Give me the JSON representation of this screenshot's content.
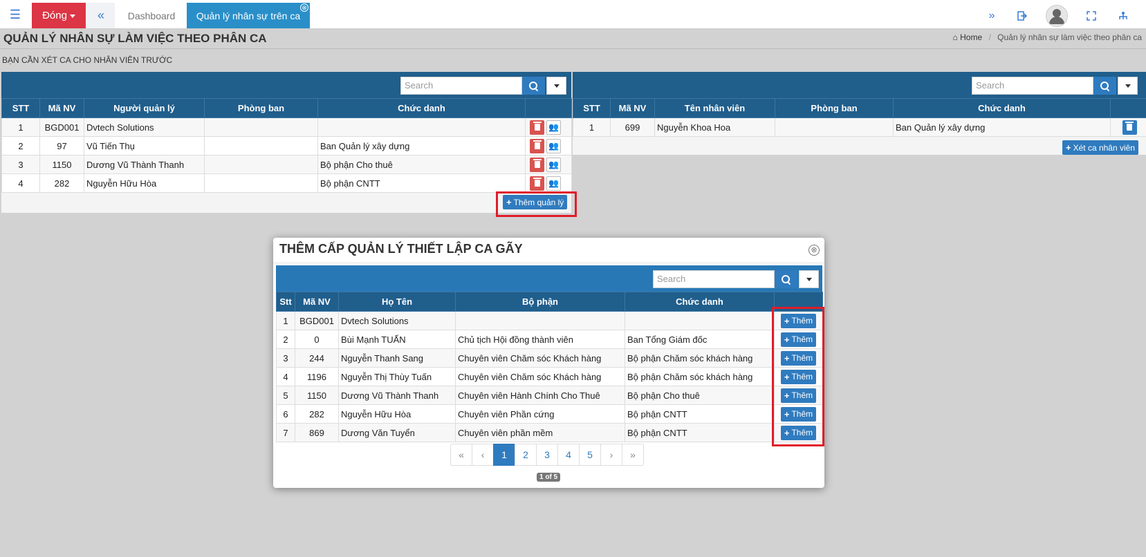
{
  "topbar": {
    "menu_icon": "hamburger-icon",
    "close_label": "Đóng",
    "tabs": [
      {
        "label": "Dashboard"
      },
      {
        "label": "Quản lý nhân sự trên ca"
      }
    ],
    "tab_close_glyph": "⊗"
  },
  "header": {
    "title": "QUẢN LÝ NHÂN SỰ LÀM VIỆC THEO PHÂN CA",
    "breadcrumb": [
      "Home",
      "Quản lý nhân sự làm việc theo phân ca"
    ],
    "notice": "BẠN CẦN XÉT CA CHO NHÂN VIÊN TRƯỚC"
  },
  "left_panel": {
    "search_placeholder": "Search",
    "columns": [
      "STT",
      "Mã NV",
      "Người quản lý",
      "Phòng ban",
      "Chức danh",
      ""
    ],
    "rows": [
      {
        "stt": "1",
        "ma_nv": "BGD001",
        "name": "Dvtech Solutions",
        "dept": "",
        "title": ""
      },
      {
        "stt": "2",
        "ma_nv": "97",
        "name": "Vũ Tiến Thụ",
        "dept": "",
        "title": "Ban Quản lý xây dựng"
      },
      {
        "stt": "3",
        "ma_nv": "1150",
        "name": "Dương Vũ Thành Thanh",
        "dept": "",
        "title": "Bộ phận Cho thuê"
      },
      {
        "stt": "4",
        "ma_nv": "282",
        "name": "Nguyễn Hữu Hòa",
        "dept": "",
        "title": "Bộ phận CNTT"
      }
    ],
    "add_button": "Thêm quản lý"
  },
  "right_panel": {
    "search_placeholder": "Search",
    "columns": [
      "STT",
      "Mã NV",
      "Tên nhân viên",
      "Phòng ban",
      "Chức danh",
      ""
    ],
    "rows": [
      {
        "stt": "1",
        "ma_nv": "699",
        "name": "Nguyễn Khoa Hoa",
        "dept": "",
        "title": "Ban Quản lý xây dựng"
      }
    ],
    "add_button": "Xét ca nhân viên"
  },
  "modal": {
    "title": "THÊM CẤP QUẢN LÝ THIẾT LẬP CA GÃY",
    "close_glyph": "⊗",
    "search_placeholder": "Search",
    "columns": [
      "Stt",
      "Mã NV",
      "Họ Tên",
      "Bộ phận",
      "Chức danh",
      ""
    ],
    "rows": [
      {
        "stt": "1",
        "ma_nv": "BGD001",
        "name": "Dvtech Solutions",
        "dept": "",
        "title": ""
      },
      {
        "stt": "2",
        "ma_nv": "0",
        "name": "Bùi Mạnh TUẤN",
        "dept": "Chủ tịch Hội đồng thành viên",
        "title": "Ban Tổng Giám đốc"
      },
      {
        "stt": "3",
        "ma_nv": "244",
        "name": "Nguyễn Thanh Sang",
        "dept": "Chuyên viên Chăm sóc Khách hàng",
        "title": "Bộ phận Chăm sóc khách hàng"
      },
      {
        "stt": "4",
        "ma_nv": "1196",
        "name": "Nguyễn Thị Thùy Tuấn",
        "dept": "Chuyên viên Chăm sóc Khách hàng",
        "title": "Bộ phận Chăm sóc khách hàng"
      },
      {
        "stt": "5",
        "ma_nv": "1150",
        "name": "Dương Vũ Thành Thanh",
        "dept": "Chuyên viên Hành Chính Cho Thuê",
        "title": "Bộ phận Cho thuê"
      },
      {
        "stt": "6",
        "ma_nv": "282",
        "name": "Nguyễn Hữu Hòa",
        "dept": "Chuyên viên Phần cứng",
        "title": "Bộ phận CNTT"
      },
      {
        "stt": "7",
        "ma_nv": "869",
        "name": "Dương Văn Tuyển",
        "dept": "Chuyên viên phần mềm",
        "title": "Bộ phận CNTT"
      }
    ],
    "row_button": "Thêm",
    "pagination": {
      "first": "«",
      "prev": "‹",
      "pages": [
        "1",
        "2",
        "3",
        "4",
        "5"
      ],
      "next": "›",
      "last": "»",
      "current": "1",
      "info": "1 of 5"
    }
  },
  "colors": {
    "header_blue": "#205e8c",
    "button_blue": "#2f7bbf",
    "danger_red": "#dc3545",
    "highlight_red": "#e01d2a"
  }
}
